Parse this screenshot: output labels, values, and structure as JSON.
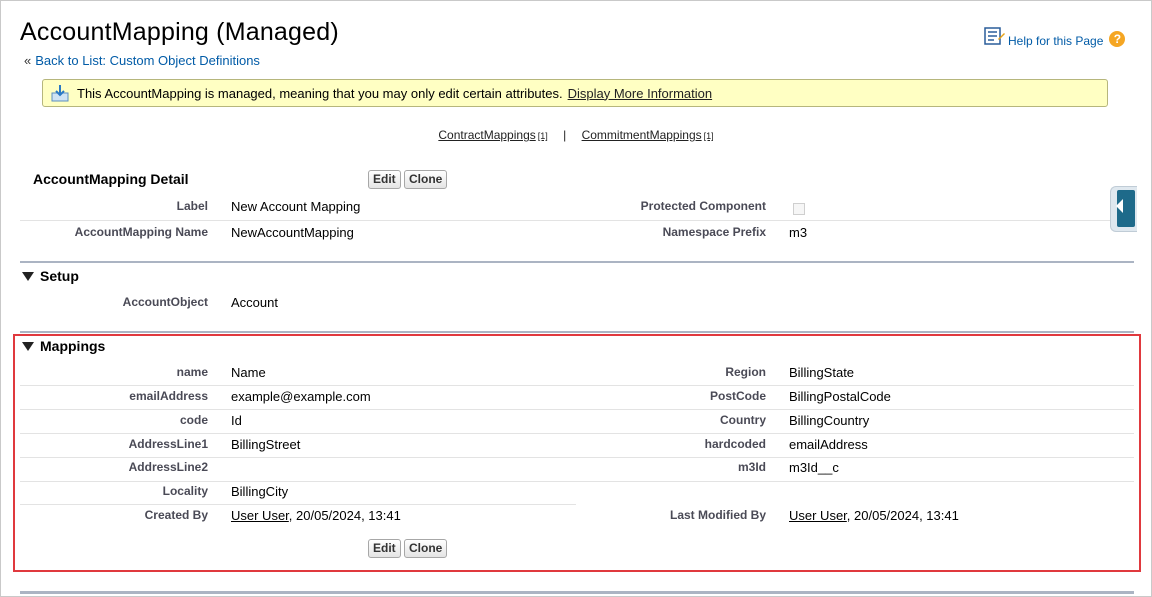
{
  "header": {
    "title": "AccountMapping (Managed)",
    "back_prefix": "«",
    "back_link": "Back to List: Custom Object Definitions",
    "help_link": "Help for this Page",
    "help_icon": "question-mark-icon"
  },
  "banner": {
    "text": "This AccountMapping is managed, meaning that you may only edit certain attributes.",
    "link": "Display More Information",
    "icon": "download-arrow-icon"
  },
  "related_lists": {
    "items": [
      {
        "label": "ContractMappings",
        "count": "[1]"
      },
      {
        "label": "CommitmentMappings",
        "count": "[1]"
      }
    ],
    "separator": "|"
  },
  "detail": {
    "title": "AccountMapping Detail",
    "edit_label": "Edit",
    "clone_label": "Clone",
    "rows": [
      {
        "l1": "Label",
        "v1": "New Account Mapping",
        "l2": "Protected Component",
        "v2": ""
      },
      {
        "l1": "AccountMapping Name",
        "v1": "NewAccountMapping",
        "l2": "Namespace Prefix",
        "v2": "m3"
      }
    ]
  },
  "setup": {
    "title": "Setup",
    "rows": [
      {
        "l1": "AccountObject",
        "v1": "Account"
      }
    ]
  },
  "mappings": {
    "title": "Mappings",
    "rows": [
      {
        "l1": "name",
        "v1": "Name",
        "l2": "Region",
        "v2": "BillingState"
      },
      {
        "l1": "emailAddress",
        "v1": "example@example.com",
        "l2": "PostCode",
        "v2": "BillingPostalCode"
      },
      {
        "l1": "code",
        "v1": "Id",
        "l2": "Country",
        "v2": "BillingCountry"
      },
      {
        "l1": "AddressLine1",
        "v1": "BillingStreet",
        "l2": "hardcoded",
        "v2": "emailAddress"
      },
      {
        "l1": "AddressLine2",
        "v1": "",
        "l2": "m3Id",
        "v2": "m3Id__c"
      },
      {
        "l1": "Locality",
        "v1": "BillingCity"
      }
    ],
    "created_by_label": "Created By",
    "created_by_user": "User User",
    "created_by_date": ", 20/05/2024, 13:41",
    "modified_by_label": "Last Modified By",
    "modified_by_user": "User User",
    "modified_by_date": ", 20/05/2024, 13:41",
    "edit_label": "Edit",
    "clone_label": "Clone"
  }
}
